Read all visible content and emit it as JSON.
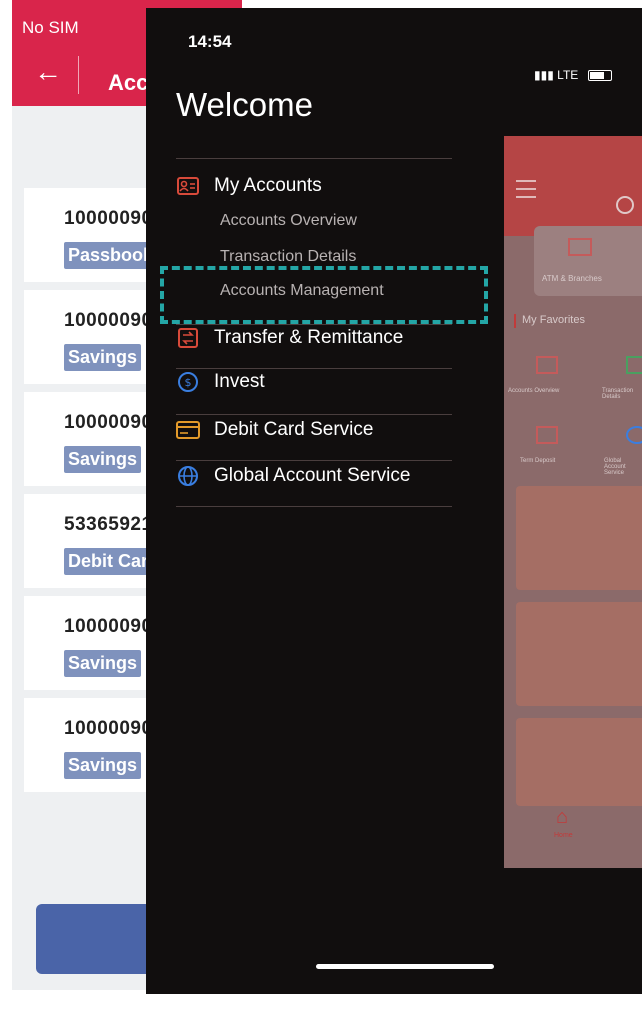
{
  "back_screen": {
    "status": "No SIM",
    "title": "Acc",
    "accounts": [
      {
        "number": "10000090",
        "type": "Passbook"
      },
      {
        "number": "10000090",
        "type": "Savings"
      },
      {
        "number": "10000090",
        "type": "Savings"
      },
      {
        "number": "53365921",
        "type": "Debit Car"
      },
      {
        "number": "10000090",
        "type": "Savings"
      },
      {
        "number": "10000090",
        "type": "Savings"
      }
    ]
  },
  "drawer": {
    "time": "14:54",
    "network": "LTE",
    "welcome": "Welcome",
    "menu": [
      {
        "label": "My Accounts",
        "icon": "accounts-card-icon"
      },
      {
        "label": "Transfer & Remittance",
        "icon": "transfer-icon"
      },
      {
        "label": "Invest",
        "icon": "invest-coin-icon"
      },
      {
        "label": "Debit Card Service",
        "icon": "debit-card-icon"
      },
      {
        "label": "Global Account Service",
        "icon": "globe-icon"
      }
    ],
    "sub_items": [
      "Accounts Overview",
      "Transaction Details",
      "Accounts Management"
    ]
  },
  "preview": {
    "atm_label": "ATM & Branches",
    "favorites": "My Favorites",
    "quick_labels": [
      "Accounts Overview",
      "Transaction Details",
      "Term Deposit",
      "Global Account Service"
    ],
    "home_label": "Home"
  },
  "colors": {
    "brand_red": "#d9254b",
    "drawer_bg": "#110e0e",
    "highlight": "#24a6a6",
    "badge": "#7f92bd"
  }
}
